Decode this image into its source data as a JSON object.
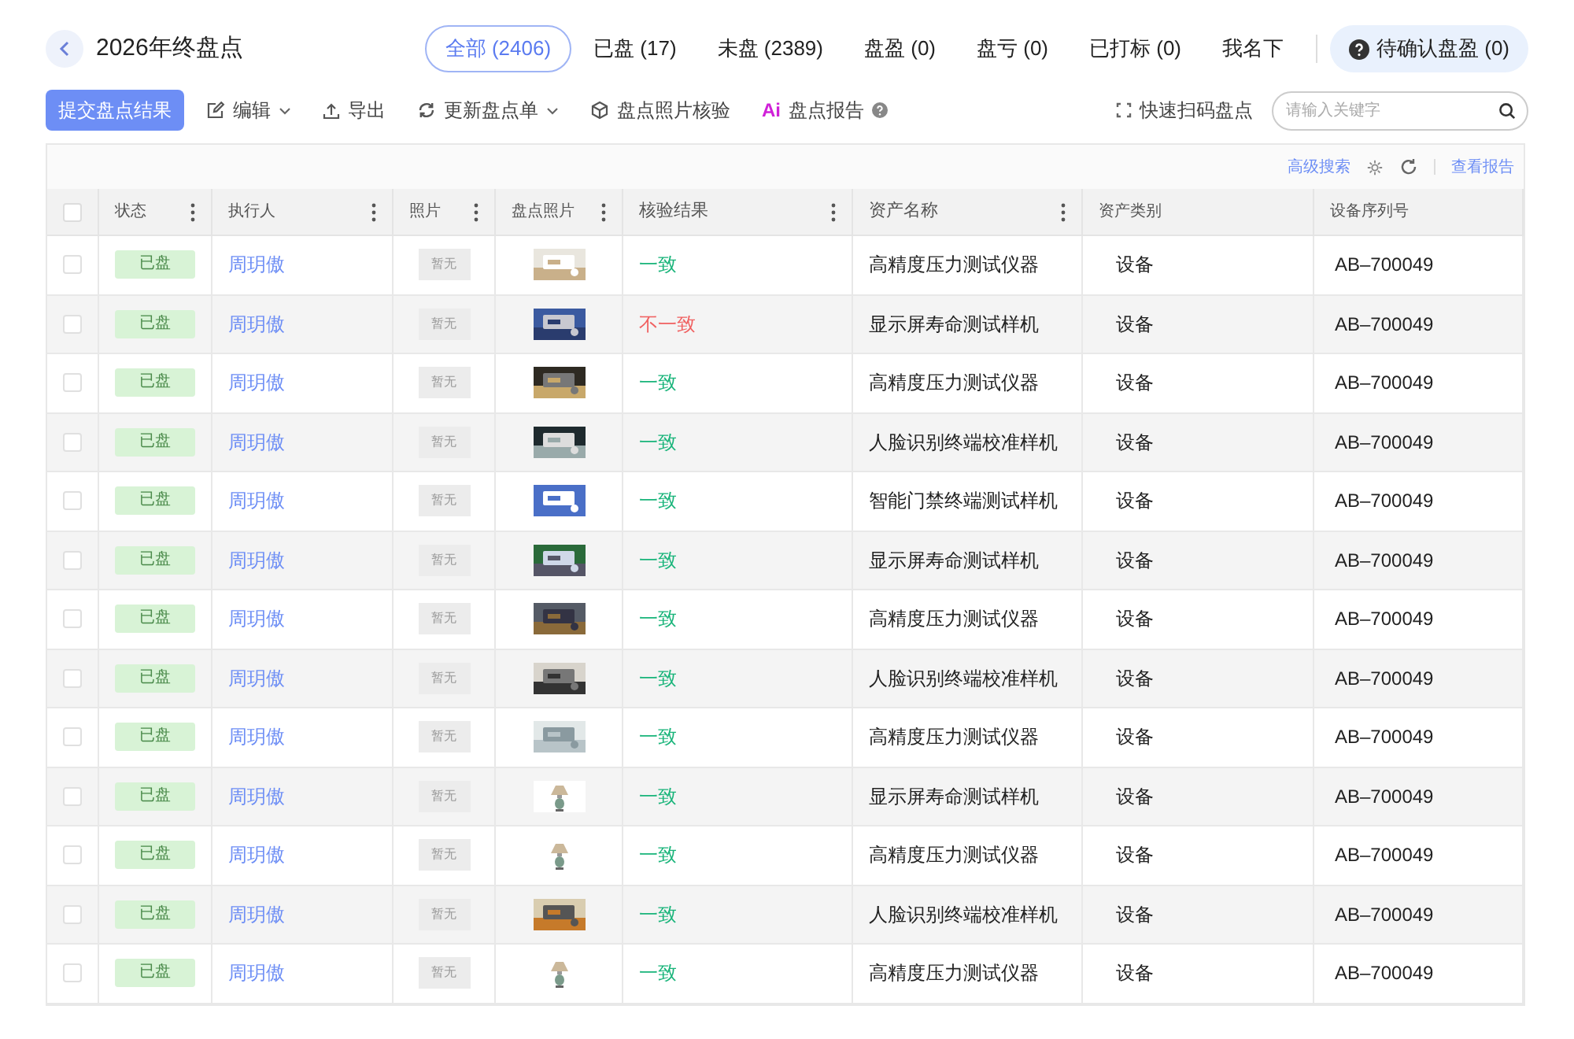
{
  "header": {
    "title": "2026年终盘点",
    "tabs": [
      {
        "label": "全部 (2406)",
        "selected": true
      },
      {
        "label": "已盘 (17)",
        "selected": false
      },
      {
        "label": "未盘 (2389)",
        "selected": false
      },
      {
        "label": "盘盈 (0)",
        "selected": false
      },
      {
        "label": "盘亏 (0)",
        "selected": false
      },
      {
        "label": "已打标 (0)",
        "selected": false
      },
      {
        "label": "我名下",
        "selected": false
      }
    ],
    "pending_button": "待确认盘盈 (0)"
  },
  "toolbar": {
    "primary_button": "提交盘点结果",
    "actions": [
      {
        "kind": "edit",
        "label": "编辑",
        "dropdown": true
      },
      {
        "kind": "export",
        "label": "导出",
        "dropdown": false
      },
      {
        "kind": "refresh",
        "label": "更新盘点单",
        "dropdown": true
      },
      {
        "kind": "verify",
        "label": "盘点照片核验",
        "dropdown": false
      },
      {
        "kind": "ai",
        "label": "盘点报告",
        "dropdown": false
      }
    ],
    "ai_mark": "Ai",
    "scan_button": "快速扫码盘点",
    "search": {
      "placeholder": "请输入关键字"
    }
  },
  "table_tools": {
    "advanced_search": "高级搜索",
    "report_link": "查看报告"
  },
  "table": {
    "columns": [
      "状态",
      "执行人",
      "照片",
      "盘点照片",
      "核验结果",
      "资产名称",
      "资产类别",
      "设备序列号"
    ],
    "select_all_checked": false,
    "rows": [
      {
        "checked": false,
        "status": "已盘",
        "executor": "周玥傲",
        "photo": "暂无",
        "result": "一致",
        "result_ok": true,
        "asset_name": "高精度压力测试仪器",
        "category": "设备",
        "serial": "AB–700049"
      },
      {
        "checked": false,
        "status": "已盘",
        "executor": "周玥傲",
        "photo": "暂无",
        "result": "不一致",
        "result_ok": false,
        "asset_name": "显示屏寿命测试样机",
        "category": "设备",
        "serial": "AB–700049"
      },
      {
        "checked": false,
        "status": "已盘",
        "executor": "周玥傲",
        "photo": "暂无",
        "result": "一致",
        "result_ok": true,
        "asset_name": "高精度压力测试仪器",
        "category": "设备",
        "serial": "AB–700049"
      },
      {
        "checked": false,
        "status": "已盘",
        "executor": "周玥傲",
        "photo": "暂无",
        "result": "一致",
        "result_ok": true,
        "asset_name": "人脸识别终端校准样机",
        "category": "设备",
        "serial": "AB–700049"
      },
      {
        "checked": false,
        "status": "已盘",
        "executor": "周玥傲",
        "photo": "暂无",
        "result": "一致",
        "result_ok": true,
        "asset_name": "智能门禁终端测试样机",
        "category": "设备",
        "serial": "AB–700049"
      },
      {
        "checked": false,
        "status": "已盘",
        "executor": "周玥傲",
        "photo": "暂无",
        "result": "一致",
        "result_ok": true,
        "asset_name": "显示屏寿命测试样机",
        "category": "设备",
        "serial": "AB–700049"
      },
      {
        "checked": false,
        "status": "已盘",
        "executor": "周玥傲",
        "photo": "暂无",
        "result": "一致",
        "result_ok": true,
        "asset_name": "高精度压力测试仪器",
        "category": "设备",
        "serial": "AB–700049"
      },
      {
        "checked": false,
        "status": "已盘",
        "executor": "周玥傲",
        "photo": "暂无",
        "result": "一致",
        "result_ok": true,
        "asset_name": "人脸识别终端校准样机",
        "category": "设备",
        "serial": "AB–700049"
      },
      {
        "checked": false,
        "status": "已盘",
        "executor": "周玥傲",
        "photo": "暂无",
        "result": "一致",
        "result_ok": true,
        "asset_name": "高精度压力测试仪器",
        "category": "设备",
        "serial": "AB–700049"
      },
      {
        "checked": false,
        "status": "已盘",
        "executor": "周玥傲",
        "photo": "暂无",
        "result": "一致",
        "result_ok": true,
        "asset_name": "显示屏寿命测试样机",
        "category": "设备",
        "serial": "AB–700049"
      },
      {
        "checked": false,
        "status": "已盘",
        "executor": "周玥傲",
        "photo": "暂无",
        "result": "一致",
        "result_ok": true,
        "asset_name": "高精度压力测试仪器",
        "category": "设备",
        "serial": "AB–700049"
      },
      {
        "checked": false,
        "status": "已盘",
        "executor": "周玥傲",
        "photo": "暂无",
        "result": "一致",
        "result_ok": true,
        "asset_name": "人脸识别终端校准样机",
        "category": "设备",
        "serial": "AB–700049"
      },
      {
        "checked": false,
        "status": "已盘",
        "executor": "周玥傲",
        "photo": "暂无",
        "result": "一致",
        "result_ok": true,
        "asset_name": "高精度压力测试仪器",
        "category": "设备",
        "serial": "AB–700049"
      }
    ]
  }
}
